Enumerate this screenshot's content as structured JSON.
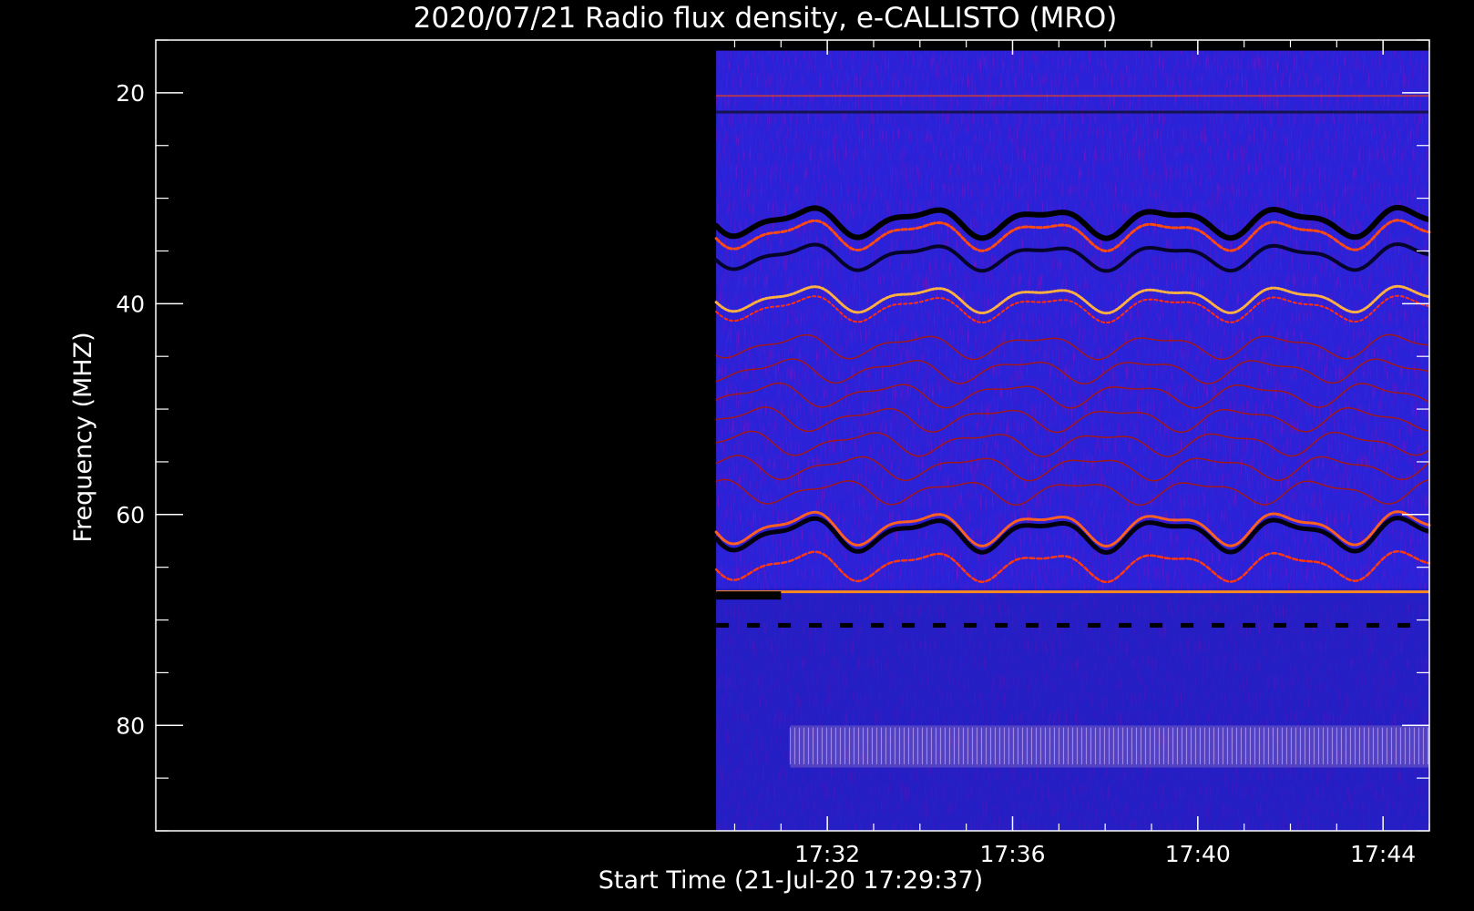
{
  "chart_data": {
    "type": "heatmap",
    "title": "2020/07/21  Radio flux density, e-CALLISTO (MRO)",
    "xlabel": "Start Time (21-Jul-20 17:29:37)",
    "ylabel": "Frequency (MHZ)",
    "x_range_minutes": [
      17.5,
      45.0
    ],
    "y_range": [
      15,
      90
    ],
    "y_axis_inverted": true,
    "x_ticks": [
      "17:32",
      "17:36",
      "17:40",
      "17:44"
    ],
    "x_tick_minutes": [
      32,
      36,
      40,
      44
    ],
    "y_ticks": [
      20,
      40,
      60,
      80
    ],
    "y_minor_ticks": [
      15,
      25,
      30,
      35,
      45,
      50,
      55,
      65,
      70,
      75,
      85,
      90
    ],
    "data_time_range_minutes": [
      29.6,
      45.0
    ],
    "data_freq_range": [
      16,
      90
    ],
    "colorscale": [
      "#000000",
      "#1a1ad0",
      "#3030ff",
      "#c01010",
      "#ff3000",
      "#ff9000",
      "#ffff60"
    ],
    "features": [
      {
        "name": "emission band",
        "freq_mhz": 33
      },
      {
        "name": "emission band",
        "freq_mhz": 39.5
      },
      {
        "name": "emission band",
        "freq_mhz": 62
      },
      {
        "name": "emission band",
        "freq_mhz": 65
      },
      {
        "name": "emission line",
        "freq_mhz": 67.2
      },
      {
        "name": "dashed line",
        "freq_mhz": 70.5
      },
      {
        "name": "interference",
        "freq_mhz": 82
      }
    ]
  }
}
